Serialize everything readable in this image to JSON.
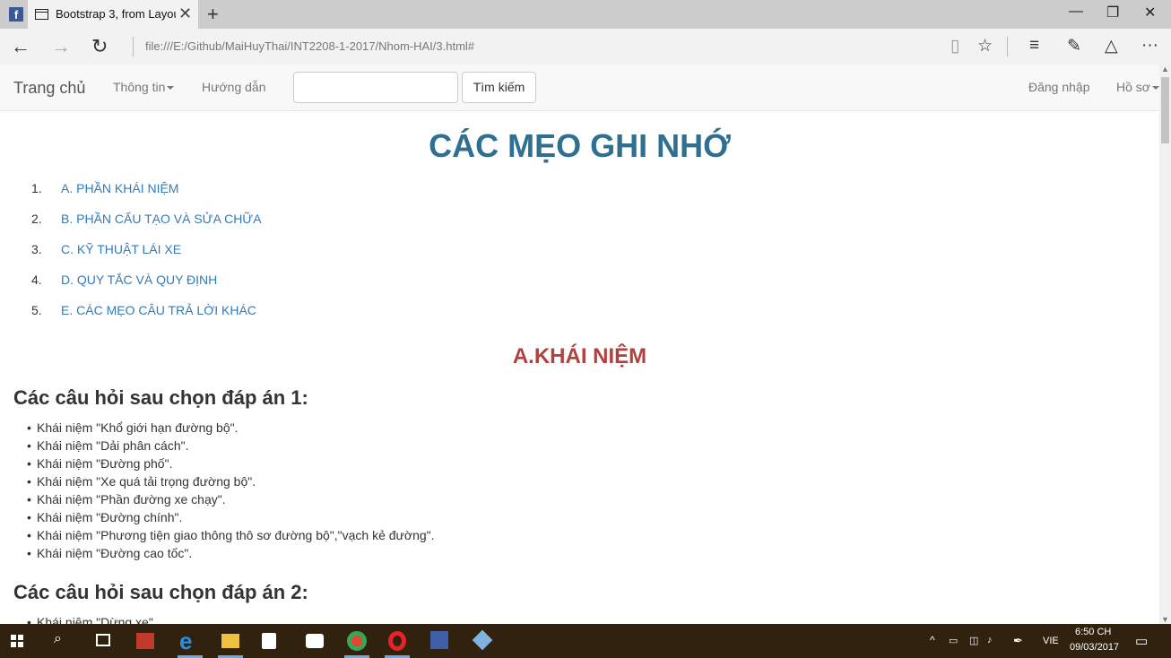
{
  "browser": {
    "tab_title": "Bootstrap 3, from Layou",
    "favicon": "f",
    "url": "file:///E:/Github/MaiHuyThai/INT2208-1-2017/Nhom-HAI/3.html#"
  },
  "navbar": {
    "brand": "Trang chủ",
    "info": "Thông tin",
    "guide": "Hướng dẫn",
    "search_value": "",
    "search_button": "Tìm kiếm",
    "login": "Đăng nhập",
    "profile": "Hồ sơ"
  },
  "page": {
    "title": "CÁC MẸO GHI NHỚ",
    "toc": [
      {
        "num": "1.",
        "label": "A. PHẦN KHÁI NIỆM"
      },
      {
        "num": "2.",
        "label": "B. PHẦN CẤU TẠO VÀ SỬA CHỮA"
      },
      {
        "num": "3.",
        "label": "C. KỸ THUẬT LÁI XE"
      },
      {
        "num": "4.",
        "label": "D. QUY TẮC VÀ QUY ĐỊNH"
      },
      {
        "num": "5.",
        "label": "E. CÁC MẸO CÂU TRẢ LỜI KHÁC"
      }
    ],
    "section_a": "A.KHÁI NIỆM",
    "q1_title": "Các câu hỏi sau chọn đáp án 1:",
    "q1_items": [
      "Khái niệm \"Khổ giới hạn đường bộ\".",
      "Khái niệm \"Dải phân cách\".",
      "Khái niệm \"Đường phố\".",
      "Khái niệm \"Xe quá tải trọng đường bộ\".",
      "Khái niệm \"Phần đường xe chạy\".",
      "Khái niệm \"Đường chính\".",
      "Khái niệm \"Phương tiện giao thông thô sơ đường bộ\",\"vạch kẻ đường\".",
      "Khái niệm \"Đường cao tốc\"."
    ],
    "q2_title": "Các câu hỏi sau chọn đáp án 2:",
    "q2_items": [
      "Khái niệm \"Dừng xe\"."
    ]
  },
  "taskbar": {
    "language": "VIE",
    "time": "6:50 CH",
    "date": "09/03/2017"
  },
  "colors": {
    "title": "#2f6f8f",
    "link": "#337ab7",
    "section": "#b0413e",
    "taskbar": "#31220f"
  }
}
